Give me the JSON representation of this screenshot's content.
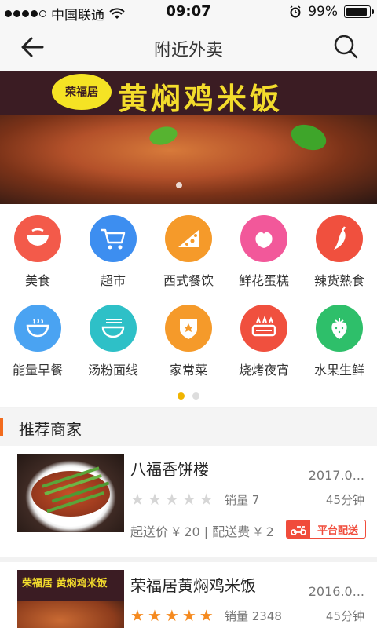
{
  "status_bar": {
    "carrier": "中国联通",
    "time": "09:07",
    "battery": "99%"
  },
  "header": {
    "title": "附近外卖",
    "back_icon": "arrow-left-icon",
    "search_icon": "search-icon"
  },
  "banner": {
    "seal_text": "荣福居",
    "title": "黄焖鸡米饭"
  },
  "categories": [
    {
      "label": "美食",
      "icon": "bowl-icon",
      "color": "#f35a4a"
    },
    {
      "label": "超市",
      "icon": "cart-icon",
      "color": "#3d8ef0"
    },
    {
      "label": "西式餐饮",
      "icon": "pizza-icon",
      "color": "#f59a2a"
    },
    {
      "label": "鲜花蛋糕",
      "icon": "peach-icon",
      "color": "#f2589a"
    },
    {
      "label": "辣货熟食",
      "icon": "pepper-icon",
      "color": "#f0503e"
    },
    {
      "label": "能量早餐",
      "icon": "breakfast-bowl-icon",
      "color": "#4aa3f2"
    },
    {
      "label": "汤粉面线",
      "icon": "noodle-icon",
      "color": "#2ec0c7"
    },
    {
      "label": "家常菜",
      "icon": "dish-icon",
      "color": "#f59a2a"
    },
    {
      "label": "烧烤夜宵",
      "icon": "grill-icon",
      "color": "#f0503e"
    },
    {
      "label": "水果生鲜",
      "icon": "strawberry-icon",
      "color": "#2ebf6a"
    }
  ],
  "section": {
    "title": "推荐商家"
  },
  "shops": [
    {
      "name": "八福香饼楼",
      "date": "2017.0...",
      "rating": 0,
      "sales": "销量 7",
      "eta": "45分钟",
      "fee": "起送价 ¥ 20 | 配送费 ¥ 2",
      "tag": "平台配送"
    },
    {
      "name": "荣福居黄焖鸡米饭",
      "date": "2016.0...",
      "rating": 5,
      "sales": "销量 2348",
      "eta": "45分钟",
      "thumb_text": "荣福居 黄焖鸡米饭"
    }
  ],
  "colors": {
    "accent": "#f26b1d",
    "star_on": "#f58a1f",
    "tag_red": "#f04c3b",
    "pager_active": "#f0b400"
  }
}
